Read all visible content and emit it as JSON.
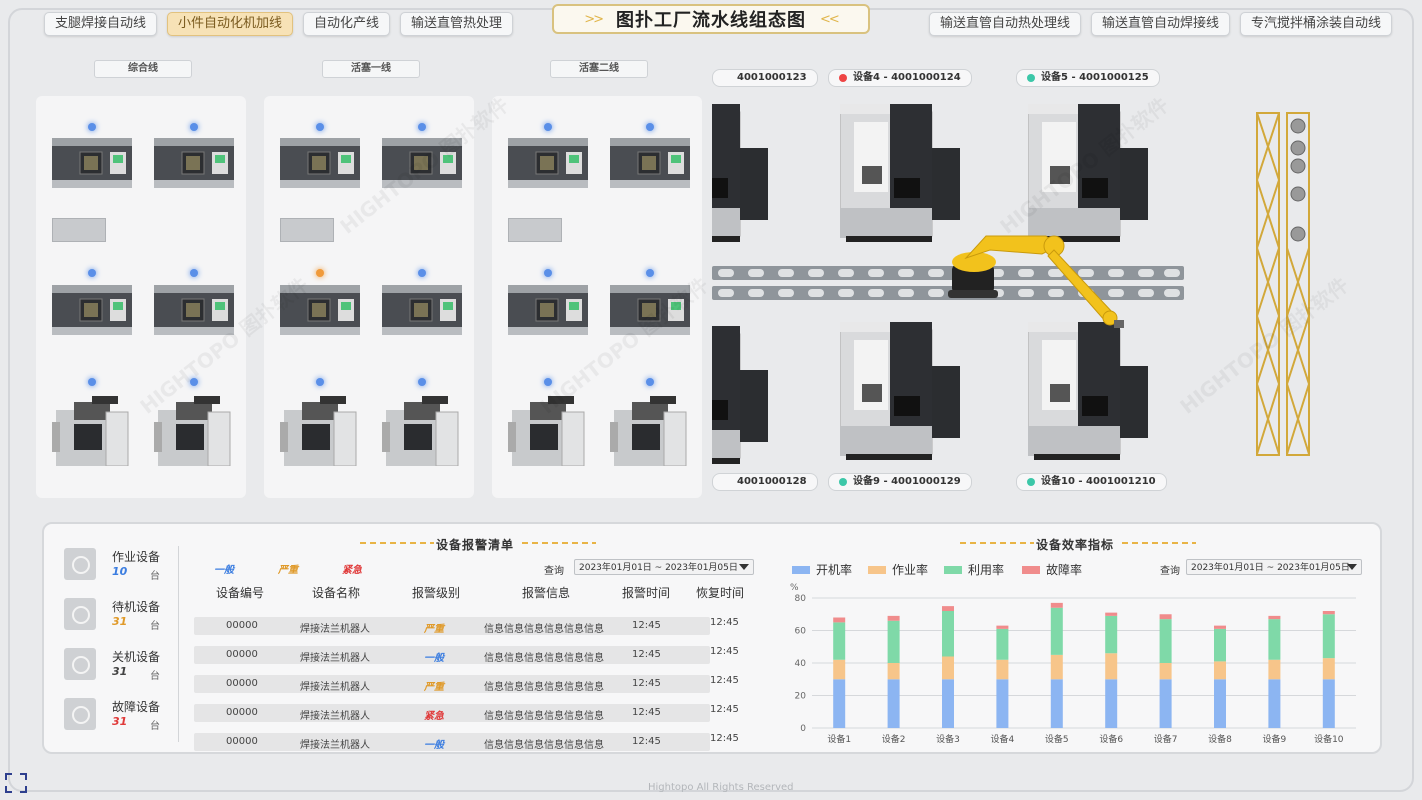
{
  "nav": {
    "left_tabs": [
      {
        "label": "支腿焊接自动线",
        "active": false
      },
      {
        "label": "小件自动化机加线",
        "active": true
      },
      {
        "label": "自动化产线",
        "active": false
      },
      {
        "label": "输送直管热处理",
        "active": false
      }
    ],
    "right_tabs": [
      {
        "label": "输送直管自动热处理线"
      },
      {
        "label": "输送直管自动焊接线"
      },
      {
        "label": "专汽搅拌桶涂装自动线"
      }
    ],
    "title": "图扑工厂流水线组态图",
    "title_chevrons": [
      ">>",
      "<<"
    ]
  },
  "sections": [
    "综合线",
    "活塞一线",
    "活塞二线"
  ],
  "devices": {
    "top": [
      {
        "label": "4001000123",
        "status": ""
      },
      {
        "label": "设备4 - 4001000124",
        "status": "red"
      },
      {
        "label": "设备5 - 4001000125",
        "status": "teal"
      }
    ],
    "bottom": [
      {
        "label": "4001000128",
        "status": ""
      },
      {
        "label": "设备9 - 4001000129",
        "status": "teal"
      },
      {
        "label": "设备10 - 4001001210",
        "status": "teal"
      }
    ]
  },
  "stats": [
    {
      "label": "作业设备",
      "value": "10",
      "unit": "台",
      "color": "#3b7de0"
    },
    {
      "label": "待机设备",
      "value": "31",
      "unit": "台",
      "color": "#e09a2a"
    },
    {
      "label": "关机设备",
      "value": "31",
      "unit": "台",
      "color": "#444444"
    },
    {
      "label": "故障设备",
      "value": "31",
      "unit": "台",
      "color": "#e03a3a"
    }
  ],
  "alarm": {
    "title": "设备报警清单",
    "levels": [
      {
        "label": "一般",
        "color": "#3b7de0"
      },
      {
        "label": "严重",
        "color": "#e09a2a"
      },
      {
        "label": "紧急",
        "color": "#e03a3a"
      }
    ],
    "query_label": "查询",
    "date_range": "2023年01月01日 ~ 2023年01月05日",
    "columns": [
      "设备编号",
      "设备名称",
      "报警级别",
      "报警信息",
      "报警时间",
      "恢复时间"
    ],
    "rows": [
      {
        "id": "00000",
        "name": "焊接法兰机器人",
        "level": "严重",
        "info": "信息信息信息信息信息信息",
        "time": "12:45",
        "recover": "12:45",
        "color": "#e09a2a"
      },
      {
        "id": "00000",
        "name": "焊接法兰机器人",
        "level": "一般",
        "info": "信息信息信息信息信息信息",
        "time": "12:45",
        "recover": "12:45",
        "color": "#3b7de0"
      },
      {
        "id": "00000",
        "name": "焊接法兰机器人",
        "level": "严重",
        "info": "信息信息信息信息信息信息",
        "time": "12:45",
        "recover": "12:45",
        "color": "#e09a2a"
      },
      {
        "id": "00000",
        "name": "焊接法兰机器人",
        "level": "紧急",
        "info": "信息信息信息信息信息信息",
        "time": "12:45",
        "recover": "12:45",
        "color": "#e03a3a"
      },
      {
        "id": "00000",
        "name": "焊接法兰机器人",
        "level": "一般",
        "info": "信息信息信息信息信息信息",
        "time": "12:45",
        "recover": "12:45",
        "color": "#3b7de0"
      }
    ]
  },
  "efficiency": {
    "title": "设备效率指标",
    "query_label": "查询",
    "date_range": "2023年01月01日 ~ 2023年01月05日"
  },
  "chart_data": {
    "type": "bar",
    "stacked": true,
    "categories": [
      "设备1",
      "设备2",
      "设备3",
      "设备4",
      "设备5",
      "设备6",
      "设备7",
      "设备8",
      "设备9",
      "设备10"
    ],
    "series": [
      {
        "name": "开机率",
        "color": "#8cb5f2",
        "values": [
          30,
          30,
          30,
          30,
          30,
          30,
          30,
          30,
          30,
          30
        ]
      },
      {
        "name": "作业率",
        "color": "#f7c58a",
        "values": [
          12,
          10,
          14,
          12,
          15,
          16,
          10,
          11,
          12,
          13
        ]
      },
      {
        "name": "利用率",
        "color": "#7fd9a8",
        "values": [
          23,
          26,
          28,
          19,
          29,
          23,
          27,
          20,
          25,
          27
        ]
      },
      {
        "name": "故障率",
        "color": "#f08c8c",
        "values": [
          3,
          3,
          3,
          2,
          3,
          2,
          3,
          2,
          2,
          2
        ]
      }
    ],
    "ylabel": "%",
    "ylim": [
      0,
      80
    ],
    "yticks": [
      0,
      20,
      40,
      60,
      80
    ],
    "grid": true,
    "legend": "top-left"
  },
  "footer": "Hightopo All Rights Reserved",
  "watermark": "HIGHTOPO 图扑软件"
}
